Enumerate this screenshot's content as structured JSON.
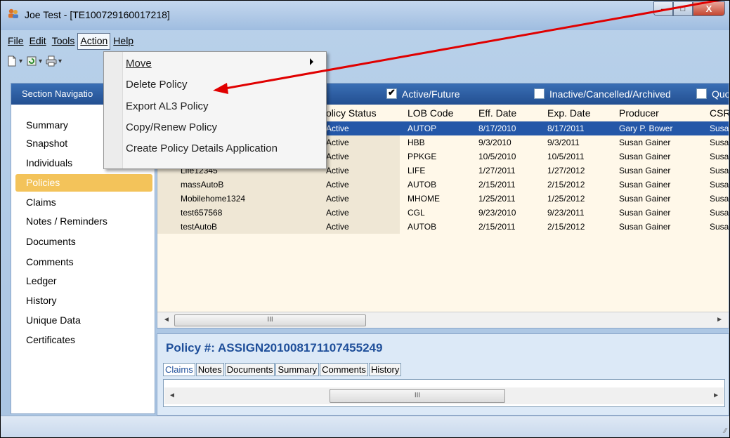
{
  "window": {
    "title": "Joe Test - [TE100729160017218]",
    "minimize_glyph": "–",
    "maximize_glyph": "□",
    "close_glyph": "X"
  },
  "menubar": {
    "file": "File",
    "edit": "Edit",
    "tools": "Tools",
    "action": "Action",
    "help": "Help"
  },
  "action_menu": {
    "items": [
      {
        "label": "Move",
        "has_submenu": true
      },
      {
        "label": "Delete Policy"
      },
      {
        "label": "Export AL3 Policy"
      },
      {
        "label": "Copy/Renew Policy"
      },
      {
        "label": "Create Policy Details Application"
      }
    ]
  },
  "section_nav": {
    "header": "Section Navigatio",
    "items": [
      {
        "label": "Summary"
      },
      {
        "label": "Snapshot"
      },
      {
        "label": "Individuals"
      },
      {
        "label": "Policies",
        "selected": true
      },
      {
        "label": "Claims"
      },
      {
        "label": "Notes / Reminders"
      },
      {
        "label": "Documents"
      },
      {
        "label": "Comments"
      },
      {
        "label": "Ledger"
      },
      {
        "label": "History"
      },
      {
        "label": "Unique Data"
      },
      {
        "label": "Certificates"
      }
    ]
  },
  "policies_filter": {
    "active_future": "Active/Future",
    "active_future_checked": true,
    "inactive": "Inactive/Cancelled/Archived",
    "inactive_checked": false,
    "quote": "Quo"
  },
  "policies_grid": {
    "columns": [
      "olicy Status",
      "LOB Code",
      "Eff. Date",
      "Exp. Date",
      "Producer",
      "CSR"
    ],
    "rows": [
      {
        "policy": "",
        "status": "Active",
        "lob": "AUTOP",
        "eff": "8/17/2010",
        "exp": "8/17/2011",
        "producer": "Gary P. Bower",
        "csr": "Susa",
        "selected": true
      },
      {
        "policy": "",
        "status": "Active",
        "lob": "HBB",
        "eff": "9/3/2010",
        "exp": "9/3/2011",
        "producer": "Susan Gainer",
        "csr": "Susa"
      },
      {
        "policy": "",
        "status": "Active",
        "lob": "PPKGE",
        "eff": "10/5/2010",
        "exp": "10/5/2011",
        "producer": "Susan Gainer",
        "csr": "Susa"
      },
      {
        "policy": "Life12345",
        "status": "Active",
        "lob": "LIFE",
        "eff": "1/27/2011",
        "exp": "1/27/2012",
        "producer": "Susan Gainer",
        "csr": "Susa"
      },
      {
        "policy": "massAutoB",
        "status": "Active",
        "lob": "AUTOB",
        "eff": "2/15/2011",
        "exp": "2/15/2012",
        "producer": "Susan Gainer",
        "csr": "Susa"
      },
      {
        "policy": "Mobilehome1324",
        "status": "Active",
        "lob": "MHOME",
        "eff": "1/25/2011",
        "exp": "1/25/2012",
        "producer": "Susan Gainer",
        "csr": "Susa"
      },
      {
        "policy": "test657568",
        "status": "Active",
        "lob": "CGL",
        "eff": "9/23/2010",
        "exp": "9/23/2011",
        "producer": "Susan Gainer",
        "csr": "Susa"
      },
      {
        "policy": "testAutoB",
        "status": "Active",
        "lob": "AUTOB",
        "eff": "2/15/2011",
        "exp": "2/15/2012",
        "producer": "Susan Gainer",
        "csr": "Susa"
      }
    ]
  },
  "scrollbar": {
    "thumb_glyph": "III",
    "left_glyph": "◄",
    "right_glyph": "►"
  },
  "policy_detail": {
    "title": "Policy #: ASSIGN201008171107455249",
    "tabs": [
      "Claims",
      "Notes",
      "Documents",
      "Summary",
      "Comments",
      "History"
    ],
    "active_tab": "Claims"
  },
  "colors": {
    "header_blue": "#2b5ea4",
    "selection_blue": "#2457a8",
    "nav_selected": "#f3c35a",
    "arrow_red": "#e00000"
  },
  "icons": {
    "app": "people-icon",
    "new": "new-document-icon",
    "refresh": "refresh-icon",
    "print": "print-icon",
    "submenu": "chevron-right-icon"
  }
}
